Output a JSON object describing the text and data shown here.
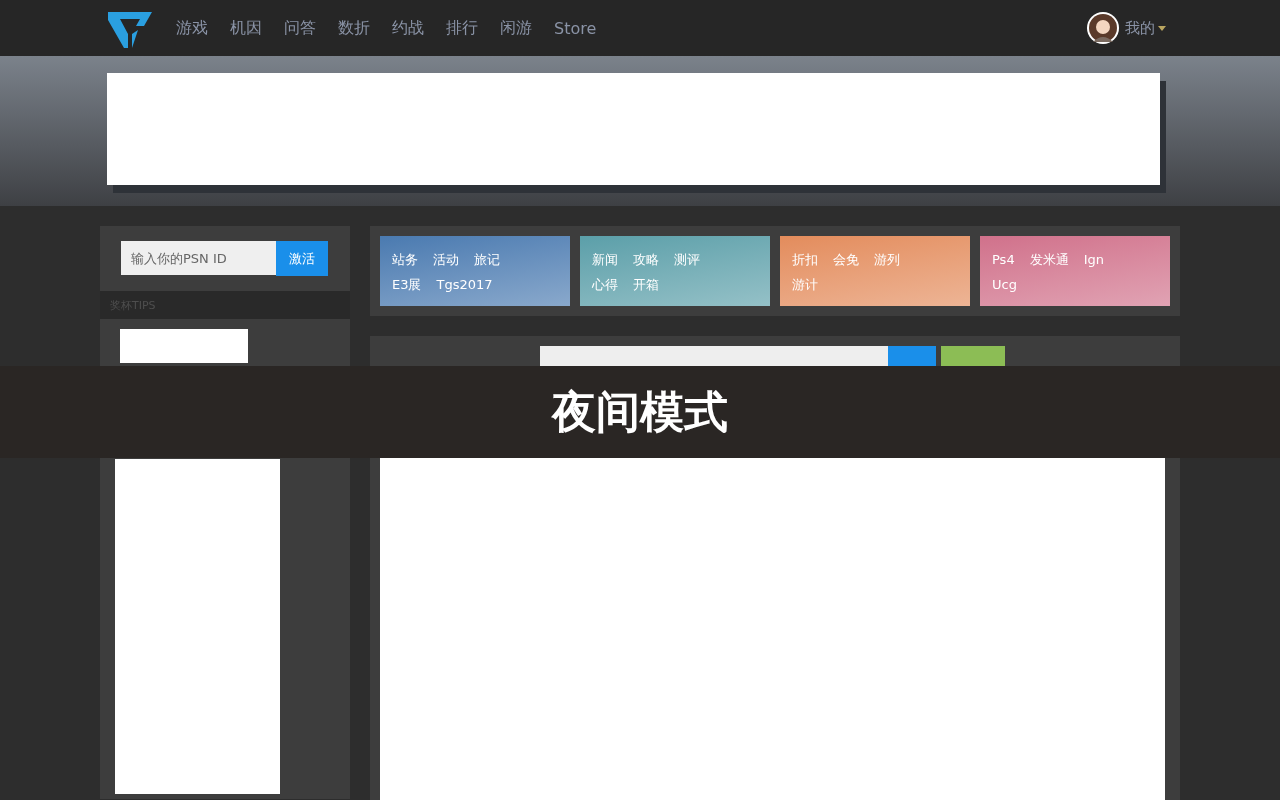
{
  "nav": {
    "items": [
      "游戏",
      "机因",
      "问答",
      "数折",
      "约战",
      "排行",
      "闲游",
      "Store"
    ],
    "user_label": "我的"
  },
  "sidebar": {
    "psn_input": {
      "placeholder": "输入你的PSN ID"
    },
    "activate_button": "激活",
    "tips_heading": "奖杯TIPS"
  },
  "categories": [
    {
      "color": "#4a7ab0",
      "rows": [
        [
          "站务",
          "活动",
          "旅记"
        ],
        [
          "E3展",
          "Tgs2017"
        ]
      ]
    },
    {
      "color": "#5b9fa9",
      "rows": [
        [
          "新闻",
          "攻略",
          "测评"
        ],
        [
          "心得",
          "开箱"
        ]
      ]
    },
    {
      "color": "#e38c5c",
      "rows": [
        [
          "折扣",
          "会免",
          "游列"
        ],
        [
          "游计"
        ]
      ]
    },
    {
      "color": "#d0718b",
      "rows": [
        [
          "Ps4",
          "发米通",
          "Ign"
        ],
        [
          "Ucg"
        ]
      ]
    }
  ],
  "overlay": {
    "title": "夜间模式"
  }
}
